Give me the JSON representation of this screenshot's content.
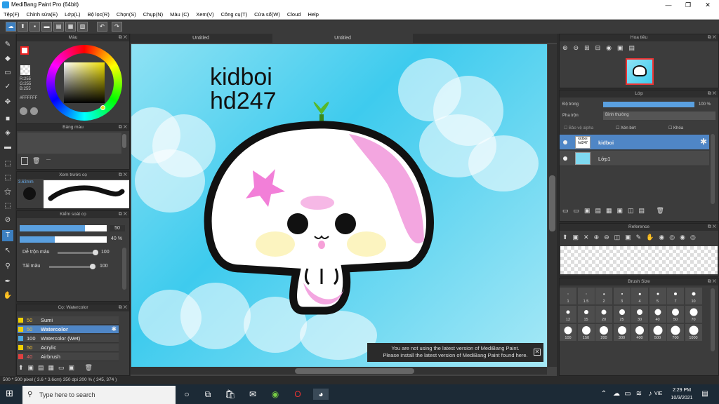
{
  "window": {
    "title": "MediBang Paint Pro (64bit)"
  },
  "menu": [
    "Tệp(F)",
    "Chỉnh sửa(E)",
    "Lớp(L)",
    "Bộ lọc(R)",
    "Chọn(S)",
    "Chụp(N)",
    "Màu (C)",
    "Xem(V)",
    "Công cụ(T)",
    "Cửa sổ(W)",
    "Cloud",
    "Help"
  ],
  "color_panel": {
    "title": "Màu",
    "r": "R:255",
    "g": "G:255",
    "b": "B:255",
    "hex": "#FFFFFF"
  },
  "palette_panel": {
    "title": "Bảng màu",
    "dash": "---"
  },
  "preview_panel": {
    "title": "Xem trước cọ",
    "size": "3.63mm"
  },
  "brush_control": {
    "title": "Kiểm soát cọ",
    "size_value": "50",
    "opacity_value": "40 %",
    "blend_label": "Dễ trộn màu",
    "blend_value": "100",
    "load_label": "Tải màu",
    "load_value": "100"
  },
  "brush_list": {
    "title": "Cọ: Watercolor",
    "items": [
      {
        "size": "50",
        "name": "Sumi",
        "color": "#f0d000"
      },
      {
        "size": "50",
        "name": "Watercolor",
        "color": "#f0d000"
      },
      {
        "size": "100",
        "name": "Watercolor (Wet)",
        "color": "#4aa8e0"
      },
      {
        "size": "50",
        "name": "Acrylic",
        "color": "#f0d000"
      },
      {
        "size": "40",
        "name": "Airbrush",
        "color": "#e04040"
      }
    ]
  },
  "canvas": {
    "tab_left": "Untitled",
    "tab_right": "Untitled",
    "text_line1": "kidboi",
    "text_line2": "hd247"
  },
  "notice": {
    "line1": "You are not using the latest version of MediBang Paint.",
    "line2": "Please install the latest version of MediBang Paint found here."
  },
  "status": "500 * 500 pixel  ( 3.6 * 3.6cm)  350 dpi  200 %  ( 345, 374 )",
  "navigator": {
    "title": "Hoa tiêu"
  },
  "layers_panel": {
    "title": "Lớp",
    "opacity_label": "Độ trong",
    "opacity_value": "100 %",
    "blend_label": "Pha trộn",
    "blend_value": "Bình thường",
    "protect_alpha": "Bảo vệ alpha",
    "clipping": "Xén bớt",
    "lock": "Khóa",
    "layers": [
      {
        "name": "kidboi",
        "thumb": "kidboi hd247",
        "selected": true
      },
      {
        "name": "Lớp1",
        "thumb": "",
        "selected": false
      }
    ]
  },
  "reference_panel": {
    "title": "Reference"
  },
  "brush_size_panel": {
    "title": "Brush Size",
    "sizes": [
      "1",
      "1.5",
      "2",
      "3",
      "4",
      "5",
      "7",
      "10",
      "12",
      "15",
      "20",
      "25",
      "30",
      "40",
      "50",
      "70",
      "100",
      "150",
      "200",
      "300",
      "400",
      "500",
      "700",
      "1000"
    ]
  },
  "taskbar": {
    "search_placeholder": "Type here to search",
    "lang": "VIE",
    "time": "2:29 PM",
    "date": "10/3/2021"
  }
}
